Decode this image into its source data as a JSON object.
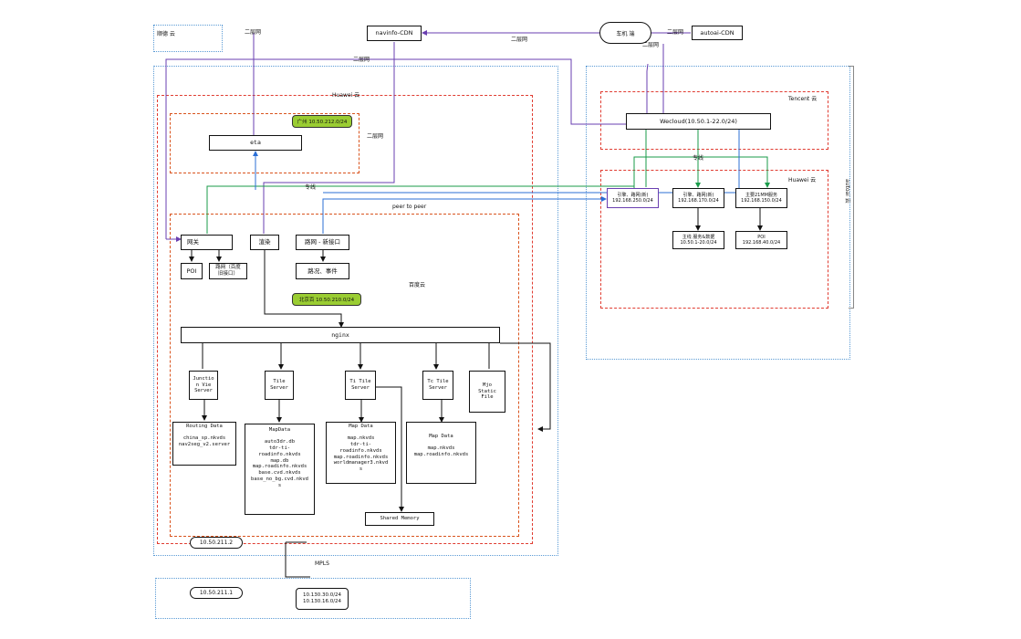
{
  "nodes": {
    "shunde": "顺德 云",
    "navinfo_cdn": "navinfo-CDN",
    "car": "车机 端",
    "autoai_cdn": "autoai-CDN",
    "huawei_left": "Huawei 云",
    "guangzhou_tag": "广州 10.50.212.0/24",
    "eta": "eta",
    "peer_to_peer": "peer to peer",
    "gateway": "网关",
    "render": "渲染",
    "route_new": "路网 - 新接口",
    "poi_left": "POI",
    "route_old": "路网（百度\n旧接口）",
    "traffic_event": "路况、事件",
    "baidu_cloud": "百度云",
    "beijing_tag": "北京百 10.50.210.0/24",
    "nginx": "nginx",
    "junction": "Junctio\nn Vie\nServer",
    "tile": "Tile\nServer",
    "ti_tile": "Ti Tile\nServer",
    "tc_tile": "Tc Tile\nServer",
    "mjo": "Mjo\nStatic\nFile",
    "routing_data_title": "Routing Data",
    "routing_data_body": "china_sp.nkvds\nnav2seg_v2.server",
    "mapdata1_title": "MapData",
    "mapdata1_body": "auto3dr.db\ntdr-ti-\nroadinfo.nkvds\nmap.db\nmap.roadinfo.nkvds\nbase.cvd.nkvds\nbase_no_bg.cvd.nkvd\ns",
    "mapdata2_title": "Map Data",
    "mapdata2_body": "map.nkvds\ntdr-ti-\nroadinfo.nkvds\nmap.roadinfo.nkvds\nworldmanager3.nkvd\ns",
    "mapdata3_title": "Map Data",
    "mapdata3_body": "map.nkvds\nmap.roadinfo.nkvds",
    "shared_memory": "Shared Memory",
    "ip_10_50_211_2": "10.50.211.2",
    "mpls": "MPLS",
    "ip_10_50_211_1": "10.50.211.1",
    "ip_bottom": "10.130.30.0/24\n10.130.16.0/24",
    "tencent": "Tencent 云",
    "wecloud": "Wecloud(10.50.1-22.0/24)",
    "huawei_right": "Huawei 云",
    "autoai_side": "autoai 云",
    "h_box1": "引擎、路网(新)\n192.168.250.0/24",
    "h_box2": "引擎、路网(新)\n192.168.170.0/24",
    "h_box3": "主要21MM服务\n192.168.150.0/24",
    "h_box4": "主线 服务&数据\n10.50.1-20.0/24",
    "h_box5": "POI\n192.168.40.0/24"
  },
  "edge_labels": {
    "l1": "二层网",
    "l2": "二层网",
    "l3": "二层网",
    "l4": "二层网",
    "l5": "二层网",
    "l6": "专线",
    "l7": "专线"
  },
  "colors": {
    "purple": "#6a3fb0",
    "green": "#1a9b4a",
    "blue": "#2b6fd6",
    "red": "#e03c31",
    "dotted_blue": "#5b9bd5",
    "tag_green": "#9acd32"
  }
}
